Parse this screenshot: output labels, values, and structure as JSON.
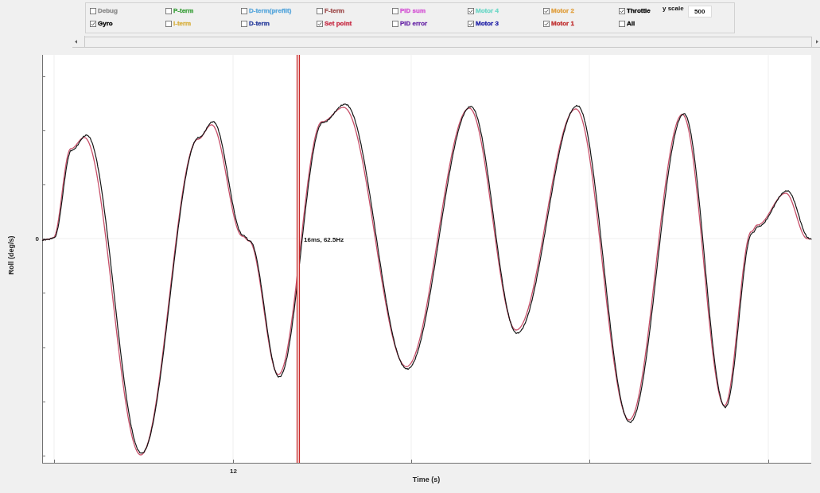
{
  "options_panel": {
    "series": [
      {
        "label": "Debug",
        "checked": false,
        "color": "#8c8c8c"
      },
      {
        "label": "P-term",
        "checked": false,
        "color": "#3ca03c"
      },
      {
        "label": "D-term(prefilt)",
        "checked": false,
        "color": "#5ba8dc"
      },
      {
        "label": "F-term",
        "checked": false,
        "color": "#a05050"
      },
      {
        "label": "PID sum",
        "checked": false,
        "color": "#d454d4"
      },
      {
        "label": "Motor 4",
        "checked": true,
        "color": "#70d8c8"
      },
      {
        "label": "Motor 2",
        "checked": true,
        "color": "#e0a040"
      },
      {
        "label": "Throttle",
        "checked": true,
        "color": "#000000"
      },
      {
        "label": "Gyro",
        "checked": true,
        "color": "#000000"
      },
      {
        "label": "I-term",
        "checked": false,
        "color": "#d8b040"
      },
      {
        "label": "D-term",
        "checked": false,
        "color": "#283c9c"
      },
      {
        "label": "Set point",
        "checked": true,
        "color": "#c83048"
      },
      {
        "label": "PID error",
        "checked": false,
        "color": "#6a2aa8"
      },
      {
        "label": "Motor 3",
        "checked": true,
        "color": "#2222a8"
      },
      {
        "label": "Motor 1",
        "checked": true,
        "color": "#c03030"
      },
      {
        "label": "All",
        "checked": false,
        "color": "#000000"
      }
    ],
    "y_scale": {
      "label": "y scale",
      "value": "500"
    }
  },
  "plot": {
    "y_axis_title": "Roll (deg/s)",
    "x_axis_title": "Time (s)",
    "y_tick_labels": [
      "0"
    ],
    "x_tick_labels": [
      "12"
    ],
    "cursor": {
      "readout": "16ms, 62.5Hz"
    }
  }
}
